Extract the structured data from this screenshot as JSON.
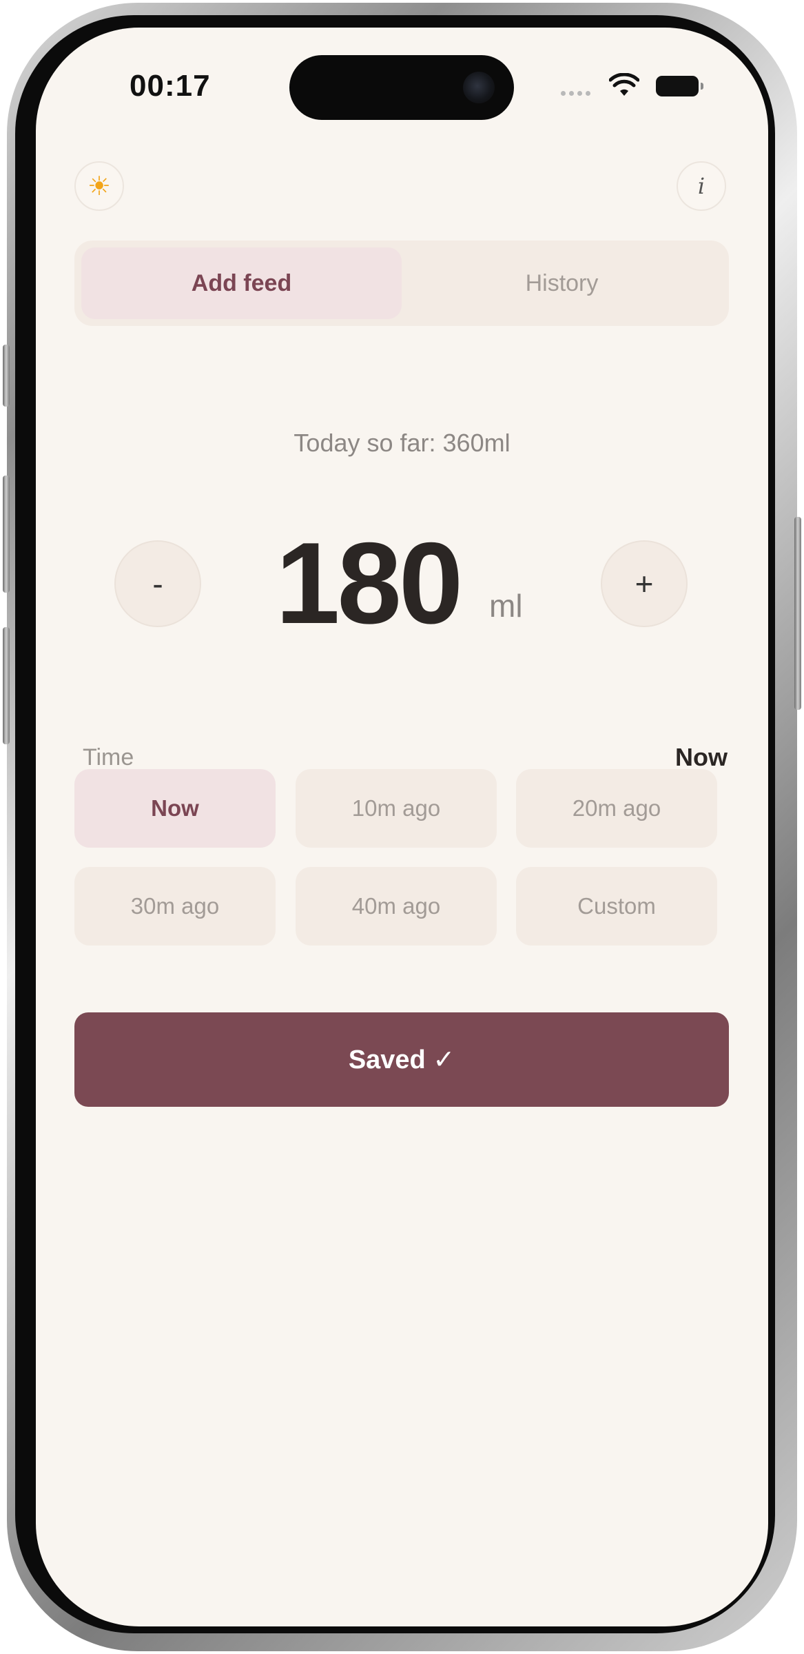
{
  "status_bar": {
    "time": "00:17"
  },
  "header": {
    "theme_icon": "sun-icon",
    "theme_glyph": "☀",
    "info_icon": "info-icon",
    "info_glyph": "i"
  },
  "tabs": [
    {
      "label": "Add feed",
      "active": true
    },
    {
      "label": "History",
      "active": false
    }
  ],
  "summary": {
    "today_text": "Today so far: 360ml"
  },
  "amount": {
    "value": "180",
    "unit": "ml",
    "decrement_label": "-",
    "increment_label": "+"
  },
  "time": {
    "label": "Time",
    "selected_value": "Now",
    "options": [
      {
        "label": "Now",
        "selected": true
      },
      {
        "label": "10m ago",
        "selected": false
      },
      {
        "label": "20m ago",
        "selected": false
      },
      {
        "label": "30m ago",
        "selected": false
      },
      {
        "label": "40m ago",
        "selected": false
      },
      {
        "label": "Custom",
        "selected": false
      }
    ]
  },
  "save_button": {
    "label": "Saved ✓"
  },
  "colors": {
    "background": "#f9f5f0",
    "accent": "#7b4953",
    "selected_bg": "#f1e2e3",
    "chip_bg": "#f3ebe4"
  }
}
